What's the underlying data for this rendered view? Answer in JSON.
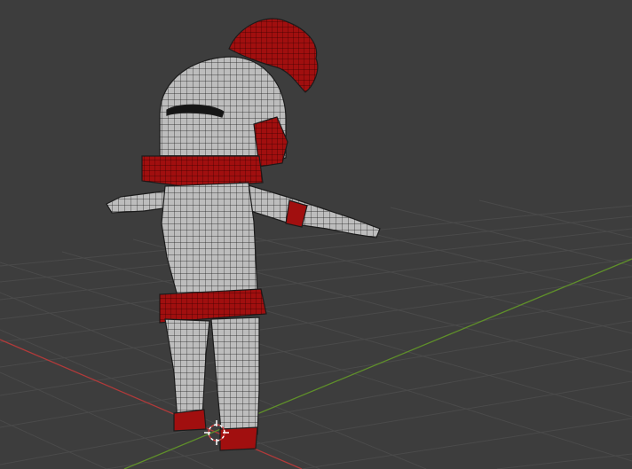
{
  "viewport": {
    "background_color": "#3d3d3d",
    "grid_color": "#4a4a4a",
    "axis_x_color": "#b03a3a",
    "axis_y_color": "#5f8f2a"
  },
  "model": {
    "armor_color": "#bdbdbd",
    "accent_color": "#a10f0f",
    "wire_color": "#1c1c1c"
  },
  "icons": {
    "origin_cursor": "3d-cursor-icon"
  }
}
